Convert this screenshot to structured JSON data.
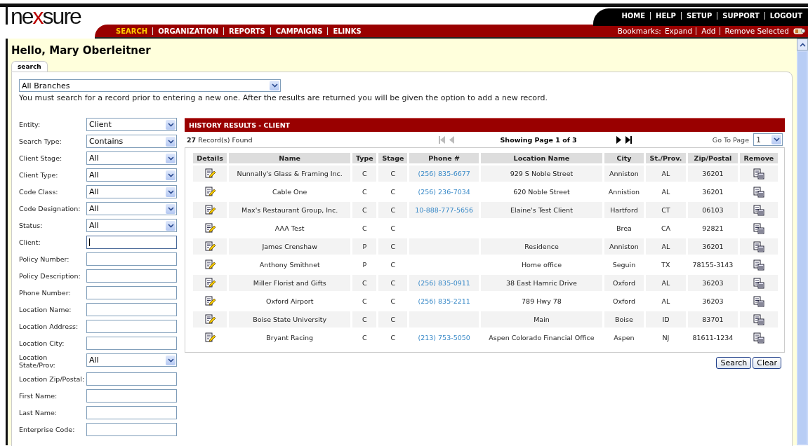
{
  "logo": {
    "before": "ne",
    "mark": "x",
    "after": "sure"
  },
  "top_links": [
    "HOME",
    "HELP",
    "SETUP",
    "SUPPORT",
    "LOGOUT"
  ],
  "nav": [
    {
      "label": "SEARCH",
      "selected": true
    },
    {
      "label": "ORGANIZATION",
      "selected": false
    },
    {
      "label": "REPORTS",
      "selected": false
    },
    {
      "label": "CAMPAIGNS",
      "selected": false
    },
    {
      "label": "ELINKS",
      "selected": false
    }
  ],
  "bookmarks": {
    "label": "Bookmarks:",
    "links": [
      "Expand",
      "Add",
      "Remove Selected"
    ]
  },
  "greeting": "Hello, Mary Oberleitner",
  "tabs": [
    {
      "label": "search",
      "selected": true
    }
  ],
  "branch_select": {
    "value": "All Branches"
  },
  "notice": "You must search for a record prior to entering a new one. After the results are returned you will be given the option to add a new record.",
  "filters": [
    {
      "label": "Entity:",
      "kind": "select",
      "value": "Client"
    },
    {
      "label": "Search Type:",
      "kind": "select",
      "value": "Contains"
    },
    {
      "label": "Client Stage:",
      "kind": "select",
      "value": "All"
    },
    {
      "label": "Client Type:",
      "kind": "select",
      "value": "All"
    },
    {
      "label": "Code Class:",
      "kind": "select",
      "value": "All"
    },
    {
      "label": "Code Designation:",
      "kind": "select",
      "value": "All"
    },
    {
      "label": "Status:",
      "kind": "select",
      "value": "All"
    },
    {
      "label": "Client:",
      "kind": "text",
      "focused": true
    },
    {
      "label": "Policy Number:",
      "kind": "text",
      "focused": false
    },
    {
      "label": "Policy Description:",
      "kind": "text",
      "focused": false
    },
    {
      "label": "Phone Number:",
      "kind": "text",
      "focused": false
    },
    {
      "label": "Location Name:",
      "kind": "text",
      "focused": false
    },
    {
      "label": "Location Address:",
      "kind": "text",
      "focused": false
    },
    {
      "label": "Location City:",
      "kind": "text",
      "focused": false
    },
    {
      "label": "Location State/Prov:",
      "kind": "select",
      "value": "All"
    },
    {
      "label": "Location Zip/Postal:",
      "kind": "text",
      "focused": false
    },
    {
      "label": "First Name:",
      "kind": "text",
      "focused": false
    },
    {
      "label": "Last Name:",
      "kind": "text",
      "focused": false
    },
    {
      "label": "Enterprise Code:",
      "kind": "text",
      "focused": false
    }
  ],
  "results": {
    "title": "HISTORY RESULTS - CLIENT",
    "count": "27",
    "count_label": "Record(s) Found",
    "pager": {
      "first_disabled": true,
      "prev_disabled": true,
      "next_disabled": false,
      "last_disabled": false,
      "text": "Showing Page 1 of 3",
      "goto_label": "Go To Page",
      "goto_value": "1"
    },
    "columns": [
      "Details",
      "Name",
      "Type",
      "Stage",
      "Phone #",
      "Location Name",
      "City",
      "St./Prov.",
      "Zip/Postal",
      "Remove"
    ],
    "rows": [
      {
        "name": "Nunnally's Glass & Framing Inc.",
        "type": "C",
        "stage": "C",
        "phone": "(256) 835-6677",
        "location": "929 S Noble Street",
        "city": "Anniston",
        "state": "AL",
        "zip": "36201"
      },
      {
        "name": "Cable One",
        "type": "C",
        "stage": "C",
        "phone": "(256) 236-7034",
        "location": "620 Noble Street",
        "city": "Annistion",
        "state": "AL",
        "zip": "36201"
      },
      {
        "name": "Max's Restaurant Group, Inc.",
        "type": "C",
        "stage": "C",
        "phone": "10-888-777-5656",
        "location": "Elaine's Test Client",
        "city": "Hartford",
        "state": "CT",
        "zip": "06103"
      },
      {
        "name": "AAA Test",
        "type": "C",
        "stage": "C",
        "city": "Brea",
        "state": "CA",
        "zip": "92821"
      },
      {
        "name": "James Crenshaw",
        "type": "P",
        "stage": "C",
        "location": "Residence",
        "city": "Anniston",
        "state": "AL",
        "zip": "36201"
      },
      {
        "name": "Anthony Smithnet",
        "type": "P",
        "stage": "C",
        "location": "Home office",
        "city": "Seguin",
        "state": "TX",
        "zip": "78155-3143"
      },
      {
        "name": "Miller Florist and Gifts",
        "type": "C",
        "stage": "C",
        "phone": "(256) 835-0911",
        "location": "38 East Hamric Drive",
        "city": "Oxford",
        "state": "AL",
        "zip": "36203"
      },
      {
        "name": "Oxford Airport",
        "type": "C",
        "stage": "C",
        "phone": "(256) 835-2211",
        "location": "789 Hwy 78",
        "city": "Oxford",
        "state": "AL",
        "zip": "36203"
      },
      {
        "name": "Boise State University",
        "type": "C",
        "stage": "C",
        "location": "Main",
        "city": "Boise",
        "state": "ID",
        "zip": "83701"
      },
      {
        "name": "Bryant Racing",
        "type": "C",
        "stage": "C",
        "phone": "(213) 753-5050",
        "location": "Aspen Colorado Financial Office",
        "city": "Aspen",
        "state": "NJ",
        "zip": "81611-1234"
      }
    ]
  },
  "buttons": [
    "Search",
    "Clear"
  ]
}
